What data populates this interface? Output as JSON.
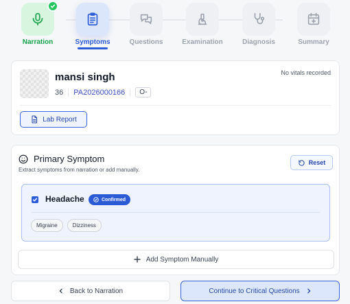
{
  "stepper": {
    "steps": [
      {
        "label": "Narration",
        "icon": "microphone-icon",
        "state": "done"
      },
      {
        "label": "Symptoms",
        "icon": "clipboard-icon",
        "state": "active"
      },
      {
        "label": "Questions",
        "icon": "chat-bubbles-icon",
        "state": "pending"
      },
      {
        "label": "Examination",
        "icon": "microscope-icon",
        "state": "pending"
      },
      {
        "label": "Diagnosis",
        "icon": "stethoscope-icon",
        "state": "pending"
      },
      {
        "label": "Summary",
        "icon": "calendar-plus-icon",
        "state": "pending"
      }
    ]
  },
  "patient": {
    "name": "mansi singh",
    "age": "36",
    "id": "PA2026000166",
    "blood_group": "O-",
    "vitals_status": "No vitals recorded",
    "lab_report_label": "Lab Report"
  },
  "primary_symptom": {
    "title": "Primary Symptom",
    "subtitle": "Extract symptoms from narration or add manually.",
    "reset_label": "Reset",
    "symptom": {
      "name": "Headache",
      "status": "Confirmed",
      "checked": true,
      "tags": [
        "Migraine",
        "Dizziness"
      ]
    },
    "add_label": "Add Symptom Manually"
  },
  "footer": {
    "back_label": "Back to Narration",
    "continue_label": "Continue to Critical Questions"
  },
  "colors": {
    "accent": "#2b5cd6",
    "success": "#22c55e",
    "done_bg": "#d8f5df",
    "active_bg": "#dbe6fb"
  }
}
